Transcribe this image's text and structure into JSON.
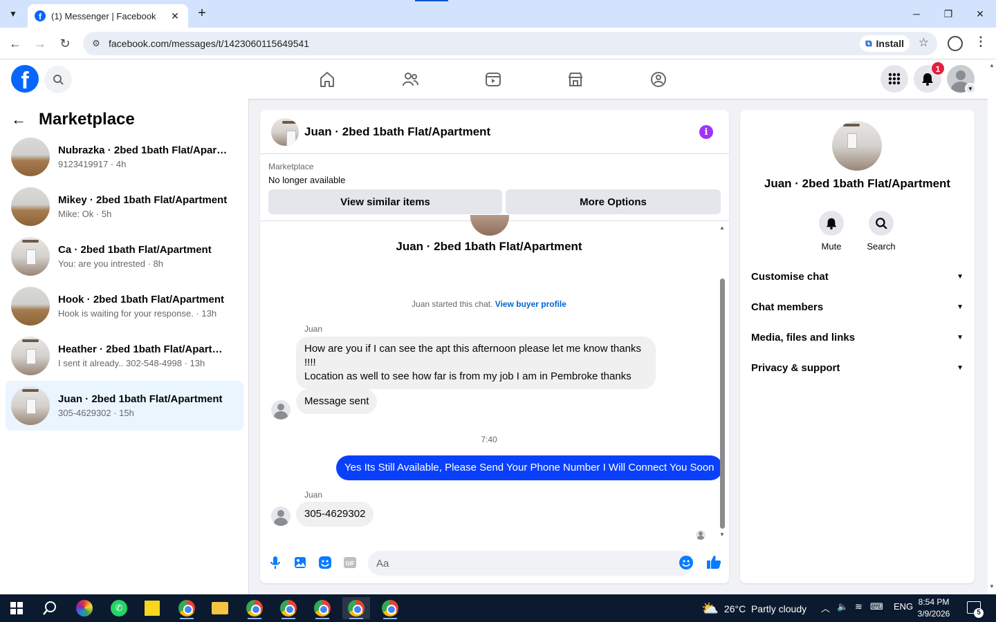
{
  "browser": {
    "tab_title": "(1) Messenger | Facebook",
    "url": "facebook.com/messages/t/1423060115649541",
    "install_label": "Install"
  },
  "header": {
    "notification_count": "1"
  },
  "left_panel": {
    "title": "Marketplace",
    "conversations": [
      {
        "name": "Nubrazka · 2bed 1bath Flat/Apart...",
        "preview": "9123419917 · 4h",
        "thumb": "wood"
      },
      {
        "name": "Mikey · 2bed 1bath Flat/Apartment",
        "preview": "Mike: Ok · 5h",
        "thumb": "wood"
      },
      {
        "name": "Ca · 2bed 1bath Flat/Apartment",
        "preview": "You: are you intrested · 8h",
        "thumb": "room"
      },
      {
        "name": "Hook · 2bed 1bath Flat/Apartment",
        "preview": "Hook is waiting for your response. · 13h",
        "thumb": "wood"
      },
      {
        "name": "Heather · 2bed 1bath Flat/Apartm...",
        "preview": "I sent it already.. 302-548-4998 · 13h",
        "thumb": "room"
      },
      {
        "name": "Juan · 2bed 1bath Flat/Apartment",
        "preview": "305-4629302 · 15h",
        "thumb": "room",
        "active": true
      }
    ]
  },
  "chat": {
    "title": "Juan · 2bed 1bath Flat/Apartment",
    "marketplace_label": "Marketplace",
    "listing_status": "No longer available",
    "view_similar_label": "View similar items",
    "more_options_label": "More Options",
    "profile_name": "Juan · 2bed 1bath Flat/Apartment",
    "started_text": "Juan started this chat.",
    "view_buyer_label": "View buyer profile",
    "messages": [
      {
        "sender": "Juan",
        "text_line1": "How are you if I can see the apt this afternoon please let me know thanks",
        "text_line2": "!!!!",
        "text_line3": "Location as well to see how far is from my job I am in Pembroke thanks"
      },
      {
        "text": "Message sent"
      },
      {
        "time": "7:40"
      },
      {
        "text": "Yes Its Still Available, Please Send Your Phone Number I Will Connect You Soon"
      },
      {
        "sender": "Juan",
        "text": "305-4629302"
      }
    ],
    "composer_placeholder": "Aa"
  },
  "right_panel": {
    "name": "Juan · 2bed 1bath Flat/Apartment",
    "mute_label": "Mute",
    "search_label": "Search",
    "sections": [
      "Customise chat",
      "Chat members",
      "Media, files and links",
      "Privacy & support"
    ]
  },
  "taskbar": {
    "weather": "26°C  Partly cloudy",
    "lang": "ENG",
    "time": "8:54 PM",
    "date": "3/9/2026",
    "notif_count": "5"
  },
  "colors": {
    "fb_blue": "#0866ff",
    "outgoing_bubble": "#0a40fc",
    "active_conv": "#ebf5ff",
    "info_purple": "#a033ff"
  }
}
